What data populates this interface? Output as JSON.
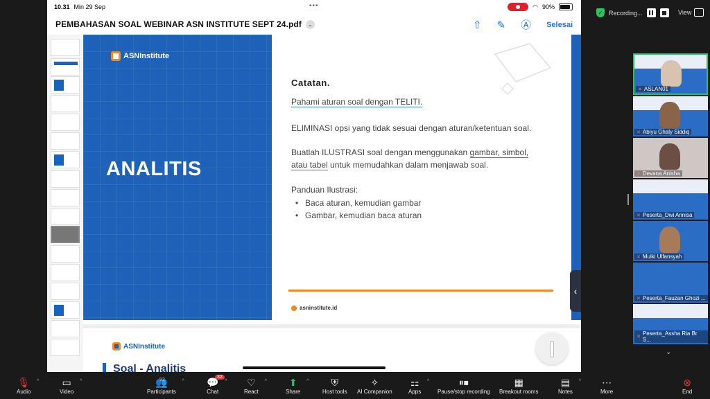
{
  "zoom_top": {
    "recording_label": "Recording...",
    "view_label": "View"
  },
  "ipad": {
    "time": "10.31",
    "date": "Min 29 Sep",
    "battery": "90%",
    "doc_title": "PEMBAHASAN SOAL WEBINAR ASN INSTITUTE SEPT 24.pdf",
    "done_label": "Selesai"
  },
  "slide": {
    "logo_text": "ASNInstitute",
    "heading": "ANALITIS",
    "notes_title": "Catatan.",
    "note1": "Pahami aturan soal dengan TELITI.",
    "note2": "ELIMINASI opsi yang tidak sesuai dengan aturan/ketentuan soal.",
    "note3_a": "Buatlah ILUSTRASI soal dengan menggunakan ",
    "note3_b": "gambar, simbol,",
    "note3_c": "atau tabel",
    "note3_d": " untuk memudahkan dalam menjawab soal.",
    "guide_title": "Panduan Ilustrasi:",
    "guide_items": [
      "Baca aturan, kemudian gambar",
      "Gambar, kemudian baca aturan"
    ],
    "website": "asninstitute.id"
  },
  "next_slide": {
    "logo_text": "ASNInstitute",
    "title": "Soal - Analitis"
  },
  "participants": [
    {
      "name": "ASLAN01"
    },
    {
      "name": "Abiyu Ghaly Siddiq"
    },
    {
      "name": "Devana Anisha"
    },
    {
      "name": "Peserta_Dwi Annisa"
    },
    {
      "name": "Mulki Ulfansyah"
    },
    {
      "name": "Peserta_Fauzan Ghozi ..."
    },
    {
      "name": "Peserta_Assha Ria Br S..."
    }
  ],
  "toolbar": {
    "audio": "Audio",
    "video": "Video",
    "participants": "Participants",
    "participants_count": "92",
    "chat": "Chat",
    "chat_badge": "32",
    "react": "React",
    "share": "Share",
    "host_tools": "Host tools",
    "ai_companion": "AI Companion",
    "apps": "Apps",
    "pause_stop": "Pause/stop recording",
    "breakout": "Breakout rooms",
    "notes": "Notes",
    "more": "More",
    "end": "End"
  },
  "colors": {
    "slide_blue": "#1d62b8",
    "accent_orange": "#f08a24",
    "ipad_link_blue": "#1a73e8",
    "active_speaker": "#27c26b",
    "end_red": "#e23b3b"
  }
}
